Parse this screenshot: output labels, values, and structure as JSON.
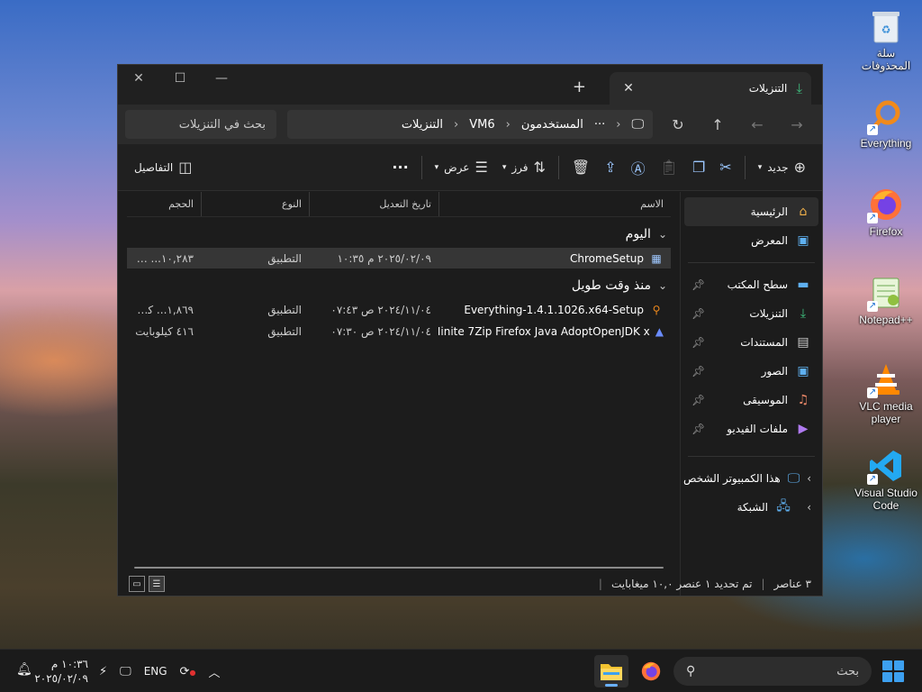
{
  "desktop_icons": [
    {
      "label": "سلة المحذوفات",
      "icon": "recycle-bin-icon"
    },
    {
      "label": "Everything",
      "icon": "everything-icon"
    },
    {
      "label": "Firefox",
      "icon": "firefox-icon"
    },
    {
      "label": "Notepad++",
      "icon": "notepadpp-icon"
    },
    {
      "label": "VLC media player",
      "icon": "vlc-icon"
    },
    {
      "label": "Visual Studio Code",
      "icon": "vscode-icon"
    }
  ],
  "window": {
    "tab_title": "التنزيلات",
    "new_tab": "+",
    "tab_close": "✕",
    "controls": {
      "minimize": "—",
      "maximize": "☐",
      "close": "✕"
    },
    "address": {
      "segments": [
        "المستخدمون",
        "VM6",
        "التنزيلات"
      ],
      "more": "···"
    },
    "search_placeholder": "بحث في التنزيلات",
    "toolbar": {
      "new_label": "جديد",
      "sort_label": "فرز",
      "view_label": "عرض",
      "more": "···",
      "details_label": "التفاصيل"
    },
    "columns": {
      "name": "الاسم",
      "date": "تاريخ التعديل",
      "type": "النوع",
      "size": "الحجم"
    },
    "groups": [
      {
        "title": "اليوم",
        "files": [
          {
            "name": "ChromeSetup",
            "date": "٢٠٢٥/٠٢/٠٩ م ١٠:٣٥",
            "type": "التطبيق",
            "size": "١٠,٢٨٣... كيلو",
            "selected": true,
            "icon": "installer-icon"
          }
        ]
      },
      {
        "title": "منذ وقت طويل",
        "files": [
          {
            "name": "Everything-1.4.1.1026.x64-Setup",
            "date": "٢٠٢٤/١١/٠٤ ص ٠٧:٤٣",
            "type": "التطبيق",
            "size": "١,٨٦٩... كيلوبا",
            "selected": false,
            "icon": "everything-icon"
          },
          {
            "name": "Ninite 7Zip Firefox Java AdoptOpenJDK x...",
            "date": "٢٠٢٤/١١/٠٤ ص ٠٧:٣٠",
            "type": "التطبيق",
            "size": "٤١٦ كيلوبايت",
            "selected": false,
            "icon": "ninite-icon"
          }
        ]
      }
    ],
    "sidebar": {
      "top": [
        {
          "label": "الرئيسية",
          "icon": "home-icon",
          "active": true
        },
        {
          "label": "المعرض",
          "icon": "gallery-icon",
          "active": false
        }
      ],
      "pinned": [
        {
          "label": "سطح المكتب",
          "icon": "desktop-icon"
        },
        {
          "label": "التنزيلات",
          "icon": "downloads-icon"
        },
        {
          "label": "المستندات",
          "icon": "documents-icon"
        },
        {
          "label": "الصور",
          "icon": "pictures-icon"
        },
        {
          "label": "الموسيقى",
          "icon": "music-icon"
        },
        {
          "label": "ملفات الفيديو",
          "icon": "videos-icon"
        }
      ],
      "bottom": [
        {
          "label": "هذا الكمبيوتر الشخص",
          "icon": "this-pc-icon"
        },
        {
          "label": "الشبكة",
          "icon": "network-icon"
        }
      ]
    },
    "status": {
      "count": "٣ عناصر",
      "selected": "تم تحديد ١ عنصر  ١٠,٠ ميغابايت"
    }
  },
  "taskbar": {
    "search_placeholder": "بحث",
    "language": "ENG",
    "time": "١٠:٣٦ م",
    "date": "٢٠٢٥/٠٢/٠٩"
  },
  "colors": {
    "accent": "#3da0f0",
    "window_bg": "#1c1c1c",
    "selection": "#363636"
  }
}
